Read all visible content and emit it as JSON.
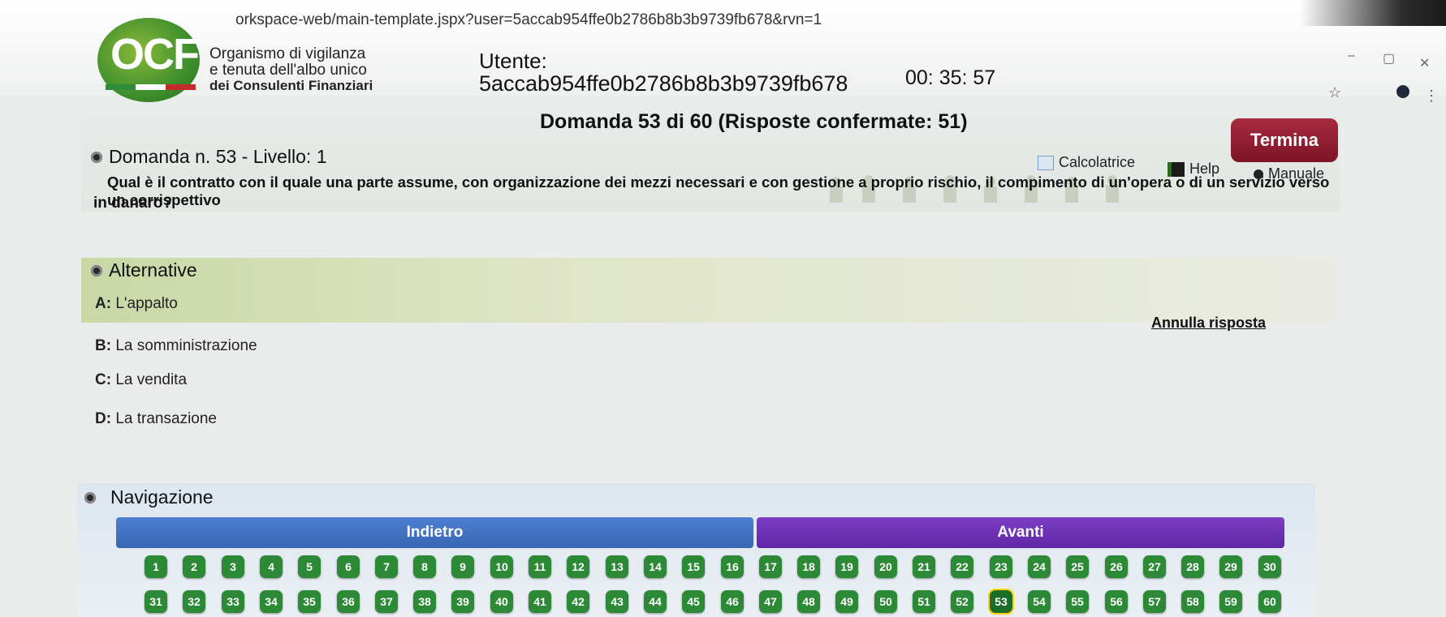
{
  "browser": {
    "url": "orkspace-web/main-template.jspx?user=5accab954ffe0b2786b8b3b9739fb678&rvn=1",
    "minimize": "–",
    "maximize": "▢",
    "close": "✕",
    "star": "☆",
    "menu": "⋮"
  },
  "header": {
    "logo_letters": "OCF",
    "org_line1": "Organismo di vigilanza",
    "org_line2": "e tenuta dell'albo unico",
    "org_line3": "dei Consulenti Finanziari",
    "utente_label": "Utente:",
    "utente_id": "5accab954ffe0b2786b8b3b9739fb678",
    "timer": "00: 35: 57",
    "progress": "Domanda 53 di 60 (Risposte confermate: 51)",
    "termina_label": "Termina",
    "tools": {
      "calcolatrice": "Calcolatrice",
      "help": "Help",
      "manuale": "Manuale"
    }
  },
  "question": {
    "heading": "Domanda n. 53 - Livello: 1",
    "text_line1": "Qual è il contratto con il quale una parte assume, con organizzazione dei mezzi necessari e con gestione a proprio rischio, il compimento di un'opera o di un servizio verso un corrispettivo",
    "text_line2": "in danaro?"
  },
  "alternatives": {
    "heading": "Alternative",
    "annulla_label": "Annulla risposta",
    "items": [
      {
        "key": "A:",
        "text": "L'appalto"
      },
      {
        "key": "B:",
        "text": "La somministrazione"
      },
      {
        "key": "C:",
        "text": "La vendita"
      },
      {
        "key": "D:",
        "text": "La transazione"
      }
    ]
  },
  "navigation": {
    "heading": "Navigazione",
    "indietro_label": "Indietro",
    "avanti_label": "Avanti",
    "current_question": 53,
    "numbers_row1": [
      "1",
      "2",
      "3",
      "4",
      "5",
      "6",
      "7",
      "8",
      "9",
      "10",
      "11",
      "12",
      "13",
      "14",
      "15",
      "16",
      "17",
      "18",
      "19",
      "20",
      "21",
      "22",
      "23",
      "24",
      "25",
      "26",
      "27",
      "28",
      "29",
      "30"
    ],
    "numbers_row2": [
      "31",
      "32",
      "33",
      "34",
      "35",
      "36",
      "37",
      "38",
      "39",
      "40",
      "41",
      "42",
      "43",
      "44",
      "45",
      "46",
      "47",
      "48",
      "49",
      "50",
      "51",
      "52",
      "53",
      "54",
      "55",
      "56",
      "57",
      "58",
      "59",
      "60"
    ]
  },
  "colors": {
    "termina": "#8b1a2e",
    "indietro": "#3f6fc2",
    "avanti": "#6a2fb3",
    "qnum": "#2c8a36"
  }
}
